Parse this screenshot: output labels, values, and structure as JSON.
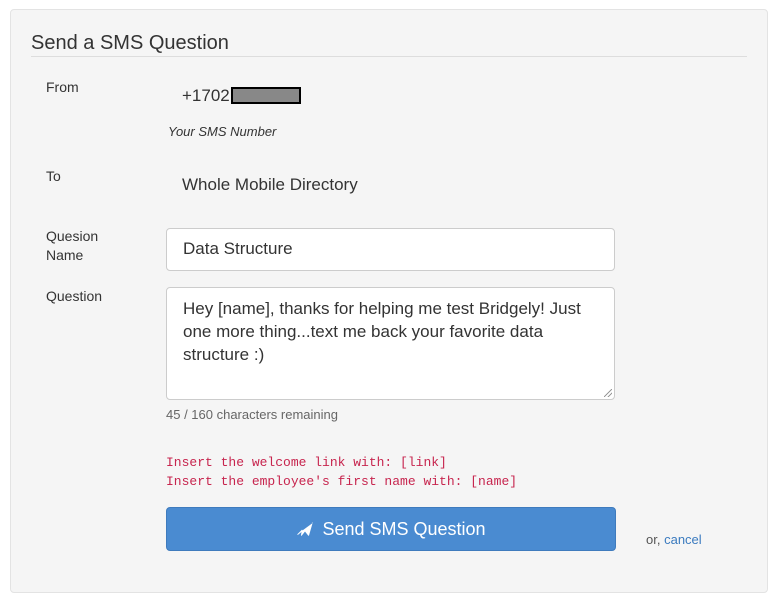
{
  "form": {
    "legend": "Send a SMS Question",
    "from": {
      "label": "From",
      "number_prefix": "+1702",
      "help": "Your SMS Number"
    },
    "to": {
      "label": "To",
      "value": "Whole Mobile Directory"
    },
    "question_name": {
      "label_line1": "Quesion",
      "label_line2": "Name",
      "value": "Data Structure"
    },
    "question": {
      "label": "Question",
      "value": "Hey [name], thanks for helping me test Bridgely! Just one more thing...text me back your favorite data structure :)",
      "counter": "45 / 160 characters remaining"
    },
    "hints": {
      "link": "Insert the welcome link with: [link]",
      "name": "Insert the employee's first name with: [name]"
    },
    "actions": {
      "submit_label": "Send SMS Question",
      "or_text": "or,",
      "cancel_label": "cancel"
    }
  },
  "icons": {
    "submit": "paper-plane-icon"
  },
  "colors": {
    "primary_button": "#4a8bd1",
    "hint_code": "#c7254e",
    "link": "#3b7bbf",
    "panel_bg": "#f5f5f5"
  }
}
